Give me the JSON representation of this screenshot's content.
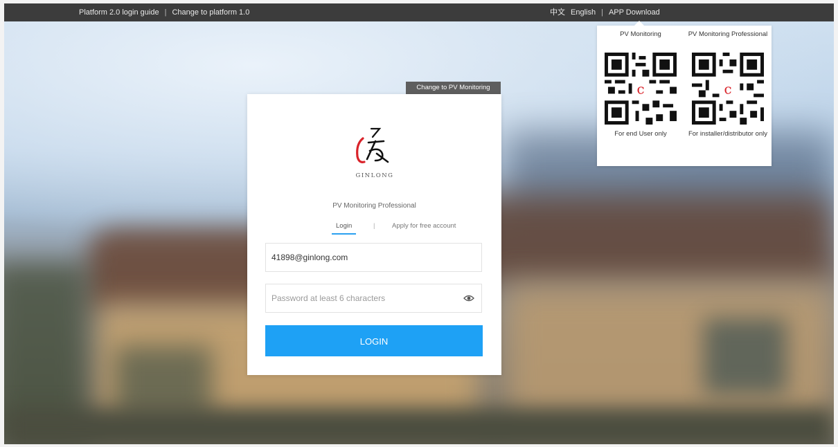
{
  "topbar": {
    "left_links": [
      {
        "label": "Platform 2.0 login guide"
      },
      {
        "label": "Change to platform 1.0"
      }
    ],
    "separator": "|",
    "lang_zh": "中文",
    "lang_en": "English",
    "app_download": "APP Download"
  },
  "app_popover": {
    "columns": [
      {
        "title": "PV Monitoring",
        "caption": "For end User only"
      },
      {
        "title": "PV Monitoring Professional",
        "caption": "For installer/distributor only"
      }
    ]
  },
  "switch_tab": "Change to PV Monitoring",
  "card": {
    "logo_text": "GINLONG",
    "product_name": "PV Monitoring Professional",
    "tab_login": "Login",
    "tab_sep": "|",
    "tab_apply": "Apply for free account",
    "email_value": "41898@ginlong.com",
    "password_placeholder": "Password at least 6 characters",
    "login_label": "LOGIN"
  },
  "colors": {
    "topbar": "#3c3c3c",
    "login_button": "#1ea1f5",
    "tab_underline": "#2aa0f0",
    "logo_red": "#d9232a"
  }
}
